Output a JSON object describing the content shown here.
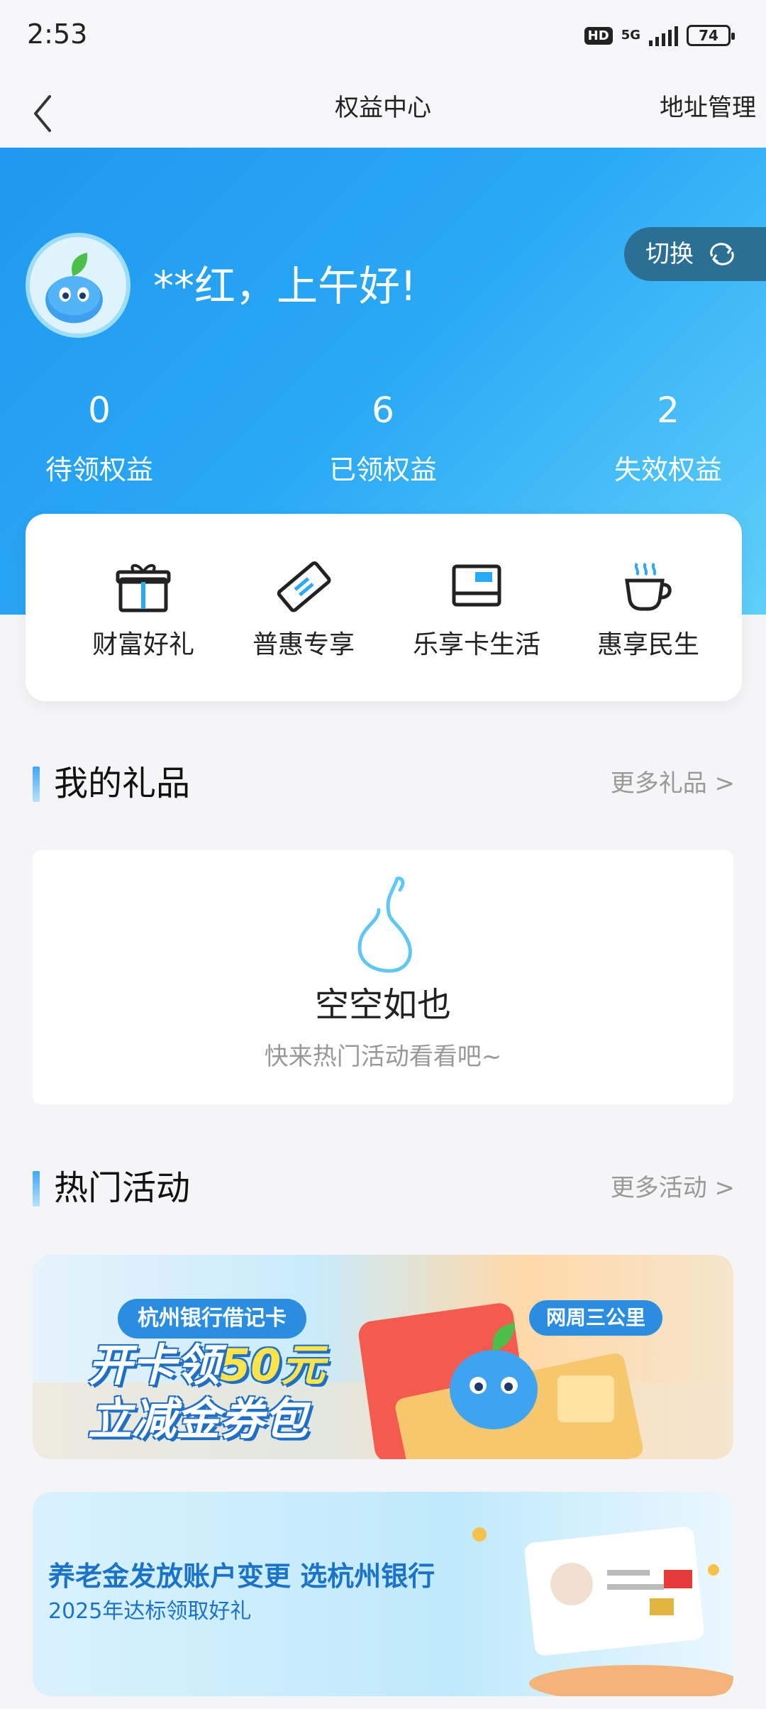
{
  "status_bar": {
    "time": "2:53",
    "hd": "HD",
    "network": "5G",
    "battery": "74"
  },
  "nav": {
    "title": "权益中心",
    "right": "地址管理"
  },
  "hero": {
    "greeting": "**红，上午好!",
    "switch_label": "切换",
    "stats": [
      {
        "value": "0",
        "label": "待领权益"
      },
      {
        "value": "6",
        "label": "已领权益"
      },
      {
        "value": "2",
        "label": "失效权益"
      }
    ]
  },
  "quick": [
    {
      "label": "财富好礼",
      "icon": "gift-icon"
    },
    {
      "label": "普惠专享",
      "icon": "ticket-icon"
    },
    {
      "label": "乐享卡生活",
      "icon": "card-icon"
    },
    {
      "label": "惠享民生",
      "icon": "cup-icon"
    }
  ],
  "gifts": {
    "title": "我的礼品",
    "more": "更多礼品 >",
    "empty_title": "空空如也",
    "empty_sub": "快来热门活动看看吧~"
  },
  "activities": {
    "title": "热门活动",
    "more": "更多活动 >"
  },
  "banner1": {
    "tag": "杭州银行借记卡",
    "line1_a": "开卡领",
    "line1_b": "50元",
    "line2": "立减金券包",
    "pill": "网周三公里"
  },
  "banner2": {
    "title": "养老金发放账户变更  选杭州银行",
    "sub": "2025年达标领取好礼"
  },
  "colors": {
    "hero_start": "#1e98f0",
    "hero_end": "#5fcff9",
    "switch_bg": "#2c6f94",
    "accent": "#2a8de0"
  }
}
